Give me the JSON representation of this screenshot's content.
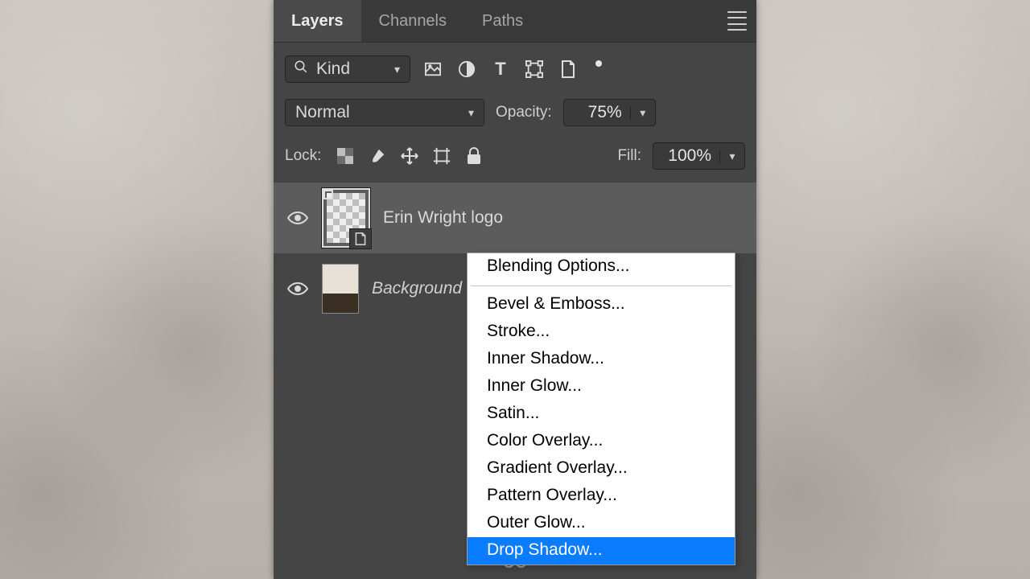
{
  "tabs": {
    "layers": "Layers",
    "channels": "Channels",
    "paths": "Paths"
  },
  "filter": {
    "label": "Kind"
  },
  "blend_mode": "Normal",
  "opacity_label": "Opacity:",
  "opacity_value": "75%",
  "lock_label": "Lock:",
  "fill_label": "Fill:",
  "fill_value": "100%",
  "layers_list": [
    {
      "name": "Erin Wright logo",
      "italic": false
    },
    {
      "name": "Background",
      "italic": true
    }
  ],
  "ctx": {
    "blending": "Blending Options...",
    "bevel": "Bevel & Emboss...",
    "stroke": "Stroke...",
    "innersh": "Inner Shadow...",
    "innergl": "Inner Glow...",
    "satin": "Satin...",
    "colorov": "Color Overlay...",
    "gradov": "Gradient Overlay...",
    "pattov": "Pattern Overlay...",
    "outergl": "Outer Glow...",
    "dropsh": "Drop Shadow..."
  }
}
